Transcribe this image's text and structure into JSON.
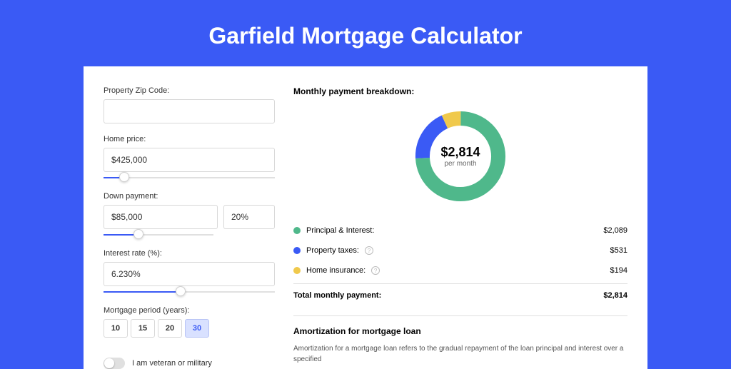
{
  "page": {
    "title": "Garfield Mortgage Calculator"
  },
  "form": {
    "zip_label": "Property Zip Code:",
    "zip_value": "",
    "home_price_label": "Home price:",
    "home_price_value": "$425,000",
    "down_payment_label": "Down payment:",
    "down_payment_value": "$85,000",
    "down_payment_pct": "20%",
    "interest_label": "Interest rate (%):",
    "interest_value": "6.230%",
    "period_label": "Mortgage period (years):",
    "periods": [
      "10",
      "15",
      "20",
      "30"
    ],
    "period_active": "30",
    "veteran_label": "I am veteran or military"
  },
  "breakdown": {
    "title": "Monthly payment breakdown:",
    "donut_amount": "$2,814",
    "donut_sub": "per month",
    "items": [
      {
        "label": "Principal & Interest:",
        "value": "$2,089",
        "color": "#4fb88b",
        "help": false
      },
      {
        "label": "Property taxes:",
        "value": "$531",
        "color": "#3a5af5",
        "help": true
      },
      {
        "label": "Home insurance:",
        "value": "$194",
        "color": "#f0c94c",
        "help": true
      }
    ],
    "total_label": "Total monthly payment:",
    "total_value": "$2,814"
  },
  "amortization": {
    "title": "Amortization for mortgage loan",
    "text": "Amortization for a mortgage loan refers to the gradual repayment of the loan principal and interest over a specified"
  },
  "slider_fills": {
    "home": 12,
    "down": 32,
    "rate": 45
  },
  "chart_data": {
    "type": "pie",
    "title": "Monthly payment breakdown",
    "series": [
      {
        "name": "Principal & Interest",
        "value": 2089,
        "color": "#4fb88b"
      },
      {
        "name": "Property taxes",
        "value": 531,
        "color": "#3a5af5"
      },
      {
        "name": "Home insurance",
        "value": 194,
        "color": "#f0c94c"
      }
    ],
    "total": 2814,
    "center_label": "$2,814 per month"
  }
}
